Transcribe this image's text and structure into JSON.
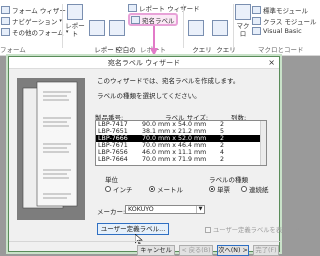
{
  "ribbon": {
    "form_wizard": "フォーム ウィザード",
    "navigation": "ナビゲーション",
    "other_forms": "その他のフォーム",
    "form_group_fragment": "フォーム",
    "report": "レポート",
    "report_design": "レポート\nデザイン",
    "blank_report": "空白の\nレポート",
    "report_wizard": "レポート ウィザード",
    "label": "宛名ラベル",
    "report_group": "レポート",
    "query_wizard": "クエリ\nウィザード",
    "query_design": "クエリ\nデザイン",
    "macro": "マクロ",
    "std_module": "標準モジュール",
    "class_module": "クラス モジュール",
    "visual_basic": "Visual Basic",
    "macro_group": "マクロとコード"
  },
  "dialog": {
    "title": "宛名ラベル ウィザード",
    "intro1": "このウィザードでは、宛名ラベルを作成します。",
    "intro2": "ラベルの種類を選択してください。",
    "col_product": "製品番号:",
    "col_size": "ラベル サイズ:",
    "col_count": "列数:",
    "rows": [
      {
        "product": "LBP-7417",
        "size": "90.0 mm x 54.0 mm",
        "count": "2"
      },
      {
        "product": "LBP-7651",
        "size": "38.1 mm x 21.2 mm",
        "count": "5"
      },
      {
        "product": "LBP-7666",
        "size": "70.0 mm x 52.0 mm",
        "count": "2"
      },
      {
        "product": "LBP-7671",
        "size": "70.0 mm x 46.4 mm",
        "count": "2"
      },
      {
        "product": "LBP-7656",
        "size": "46.0 mm x 11.1 mm",
        "count": "4"
      },
      {
        "product": "LBP-7664",
        "size": "70.0 mm x 71.9 mm",
        "count": "2"
      }
    ],
    "unit_label": "単位",
    "unit_inch": "インチ",
    "unit_metric": "メートル",
    "type_label": "ラベルの種類",
    "type_single": "単票",
    "type_cont": "連続紙",
    "maker_label": "メーカー:",
    "maker_value": "KOKUYO",
    "custom_button": "ユーザー定義ラベル...",
    "custom_check": "ユーザー定義ラベルを表示する",
    "cancel": "キャンセル",
    "back": "< 戻る(B)",
    "next": "次へ(N) >",
    "finish": "完了(F)"
  }
}
